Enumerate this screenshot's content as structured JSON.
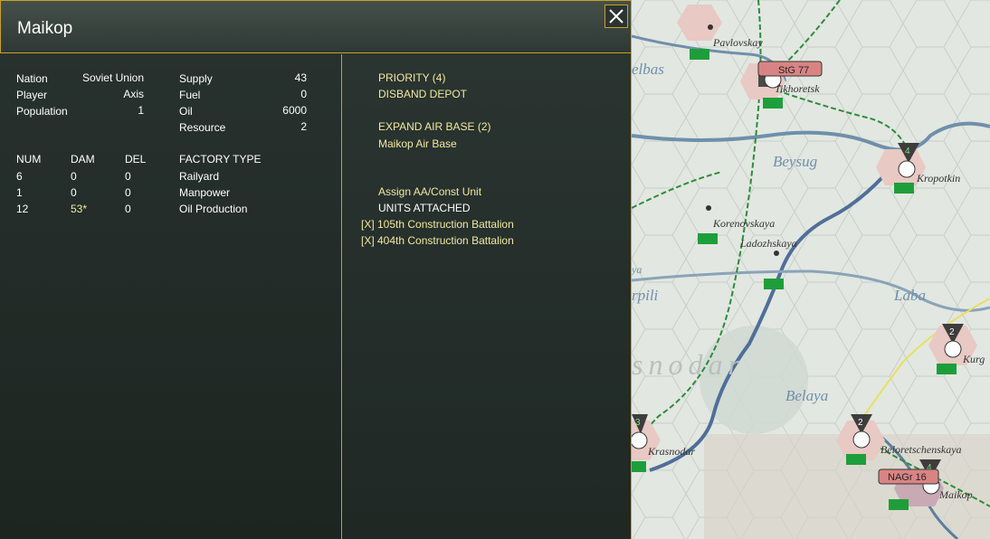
{
  "dialog": {
    "title": "Maikop",
    "close_icon": "close-x-icon"
  },
  "stats_left": [
    {
      "label": "Nation",
      "value": "Soviet Union"
    },
    {
      "label": "Player",
      "value": "Axis"
    },
    {
      "label": "Population",
      "value": "1"
    }
  ],
  "stats_right": [
    {
      "label": "Supply",
      "value": "43"
    },
    {
      "label": "Fuel",
      "value": "0"
    },
    {
      "label": "Oil",
      "value": "6000"
    },
    {
      "label": "Resource",
      "value": "2"
    }
  ],
  "factory_table": {
    "headers": [
      "NUM",
      "DAM",
      "DEL",
      "FACTORY TYPE"
    ],
    "rows": [
      {
        "num": "6",
        "dam": "0",
        "del": "0",
        "type": "Railyard"
      },
      {
        "num": "1",
        "dam": "0",
        "del": "0",
        "type": "Manpower"
      },
      {
        "num": "12",
        "dam": "53*",
        "del": "0",
        "type": "Oil Production"
      }
    ]
  },
  "actions": {
    "priority": "PRIORITY (4)",
    "disband": "DISBAND DEPOT",
    "expand_air": "EXPAND AIR BASE (2)",
    "air_base": "Maikop Air Base",
    "assign": "Assign AA/Const Unit",
    "units_attached": "UNITS ATTACHED",
    "unit1": "[X] 105th Construction Battalion",
    "unit2": "[X] 404th Construction Battalion"
  },
  "map": {
    "towns": [
      "Pavlovskay",
      "Tikhoretsk",
      "Kropotkin",
      "Korenovskaya",
      "Ladozhskaya",
      "Krasnodar",
      "Beloretschenskaya",
      "Maikop",
      "Kurg"
    ],
    "rivers": [
      "elbas",
      "Beysug",
      "Laba",
      "Belaya",
      "rpili",
      "ya"
    ],
    "region": "snodar",
    "unit_labels": [
      "StG 77",
      "NAGr 16"
    ],
    "stack_numbers": [
      "4",
      "2",
      "2",
      "3",
      "4"
    ],
    "colors": {
      "river": "#5b7f9e",
      "rail": "#2e8b3a",
      "road": "#e8e060",
      "urban": "#e8c9c4",
      "unit_label": "#d98484"
    }
  }
}
